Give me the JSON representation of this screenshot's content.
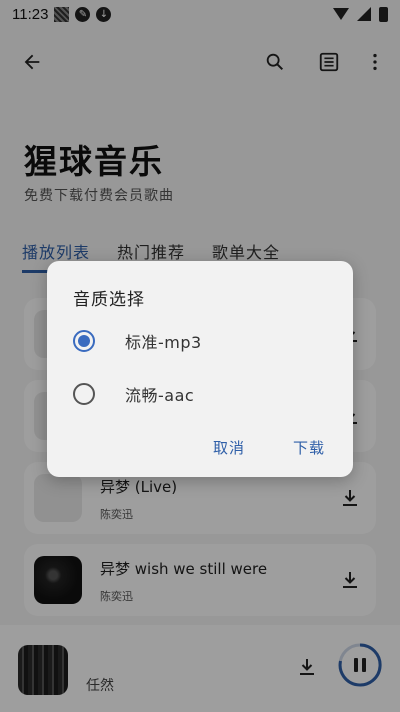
{
  "status_bar": {
    "time": "11:23"
  },
  "app": {
    "title": "猩球音乐",
    "subtitle": "免费下载付费会员歌曲"
  },
  "tabs": [
    {
      "label": "播放列表",
      "active": true
    },
    {
      "label": "热门推荐",
      "active": false
    },
    {
      "label": "歌单大全",
      "active": false
    }
  ],
  "songs": [
    {
      "title": "",
      "artist": ""
    },
    {
      "title": "",
      "artist": ""
    },
    {
      "title": "异梦 (Live)",
      "artist": "陈奕迅"
    },
    {
      "title": "异梦 wish we still were",
      "artist": "陈奕迅"
    }
  ],
  "player": {
    "artist": "任然"
  },
  "dialog": {
    "title": "音质选择",
    "options": [
      {
        "label": "标准-mp3",
        "selected": true
      },
      {
        "label": "流畅-aac",
        "selected": false
      }
    ],
    "cancel_label": "取消",
    "confirm_label": "下载"
  },
  "colors": {
    "accent": "#2f5fa8",
    "radio_accent": "#3a6bbf",
    "scrim": "rgba(0,0,0,0.38)"
  },
  "icons": {
    "back": "arrow-left-icon",
    "search": "search-icon",
    "list": "list-icon",
    "more": "more-vert-icon",
    "download": "download-icon",
    "pause": "pause-icon"
  }
}
